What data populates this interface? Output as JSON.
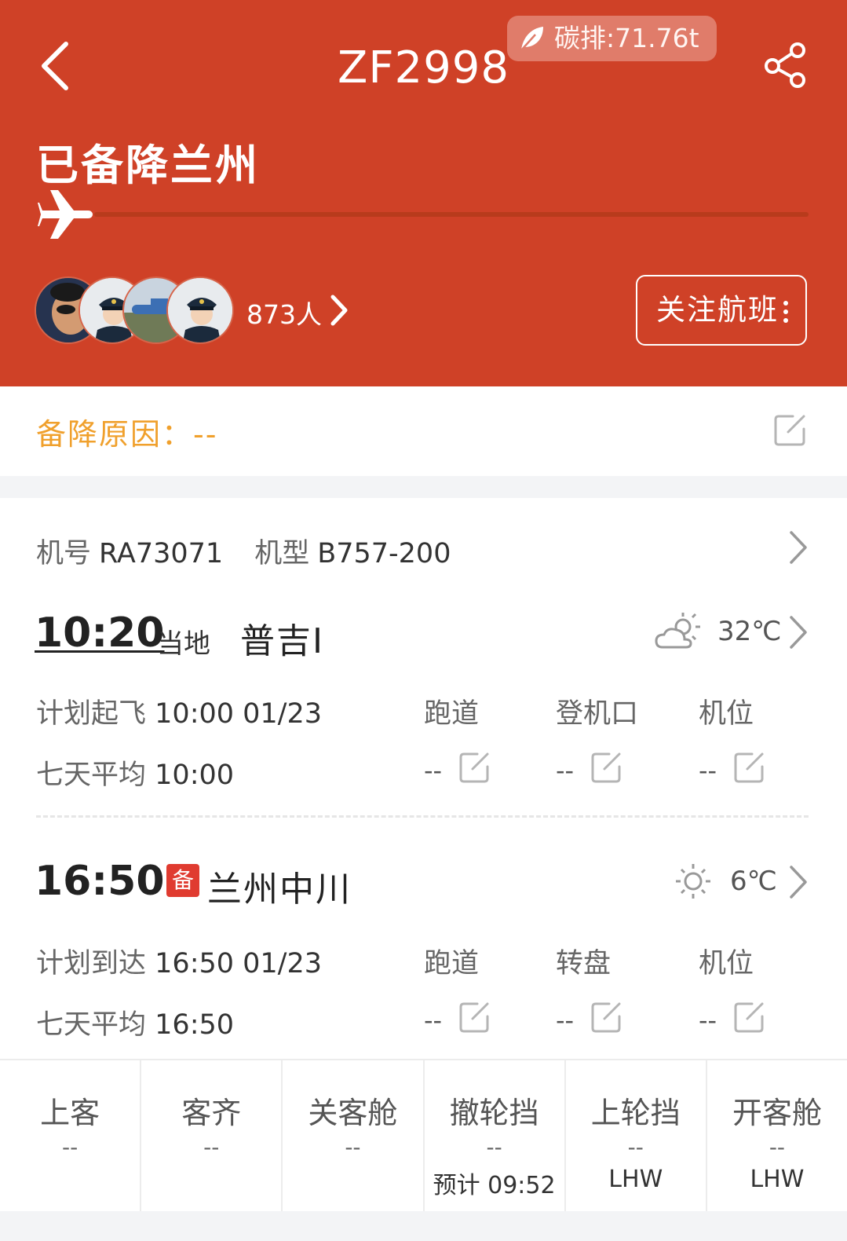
{
  "header": {
    "flight_no": "ZF2998",
    "carbon": "碳排:71.76t",
    "status": "已备降兰州",
    "followers": "873人",
    "follow_btn": "关注航班"
  },
  "reason": {
    "text": "备降原因：--"
  },
  "aircraft": {
    "reg_label": "机号",
    "reg": "RA73071",
    "type_label": "机型",
    "type": "B757-200"
  },
  "departure": {
    "time": "10:20",
    "local": "当地",
    "airport": "普吉I",
    "temp": "32℃",
    "plan_label": "计划起飞",
    "plan": "10:00 01/23",
    "avg_label": "七天平均",
    "avg": "10:00",
    "cols": [
      "跑道",
      "登机口",
      "机位"
    ],
    "vals": [
      "--",
      "--",
      "--"
    ]
  },
  "arrival": {
    "time": "16:50",
    "alt_badge": "备",
    "airport": "兰州中川",
    "temp": "6℃",
    "plan_label": "计划到达",
    "plan": "16:50 01/23",
    "avg_label": "七天平均",
    "avg": "16:50",
    "cols": [
      "跑道",
      "转盘",
      "机位"
    ],
    "vals": [
      "--",
      "--",
      "--"
    ]
  },
  "events": [
    {
      "name": "上客",
      "value": "--",
      "note": ""
    },
    {
      "name": "客齐",
      "value": "--",
      "note": ""
    },
    {
      "name": "关客舱",
      "value": "--",
      "note": ""
    },
    {
      "name": "撤轮挡",
      "value": "--",
      "note": "预计 09:52"
    },
    {
      "name": "上轮挡",
      "value": "--",
      "note": "LHW"
    },
    {
      "name": "开客舱",
      "value": "--",
      "note": "LHW"
    }
  ],
  "colors": {
    "header": "#cf4127",
    "reason": "#f0a02c",
    "alt_badge": "#e03b30"
  }
}
